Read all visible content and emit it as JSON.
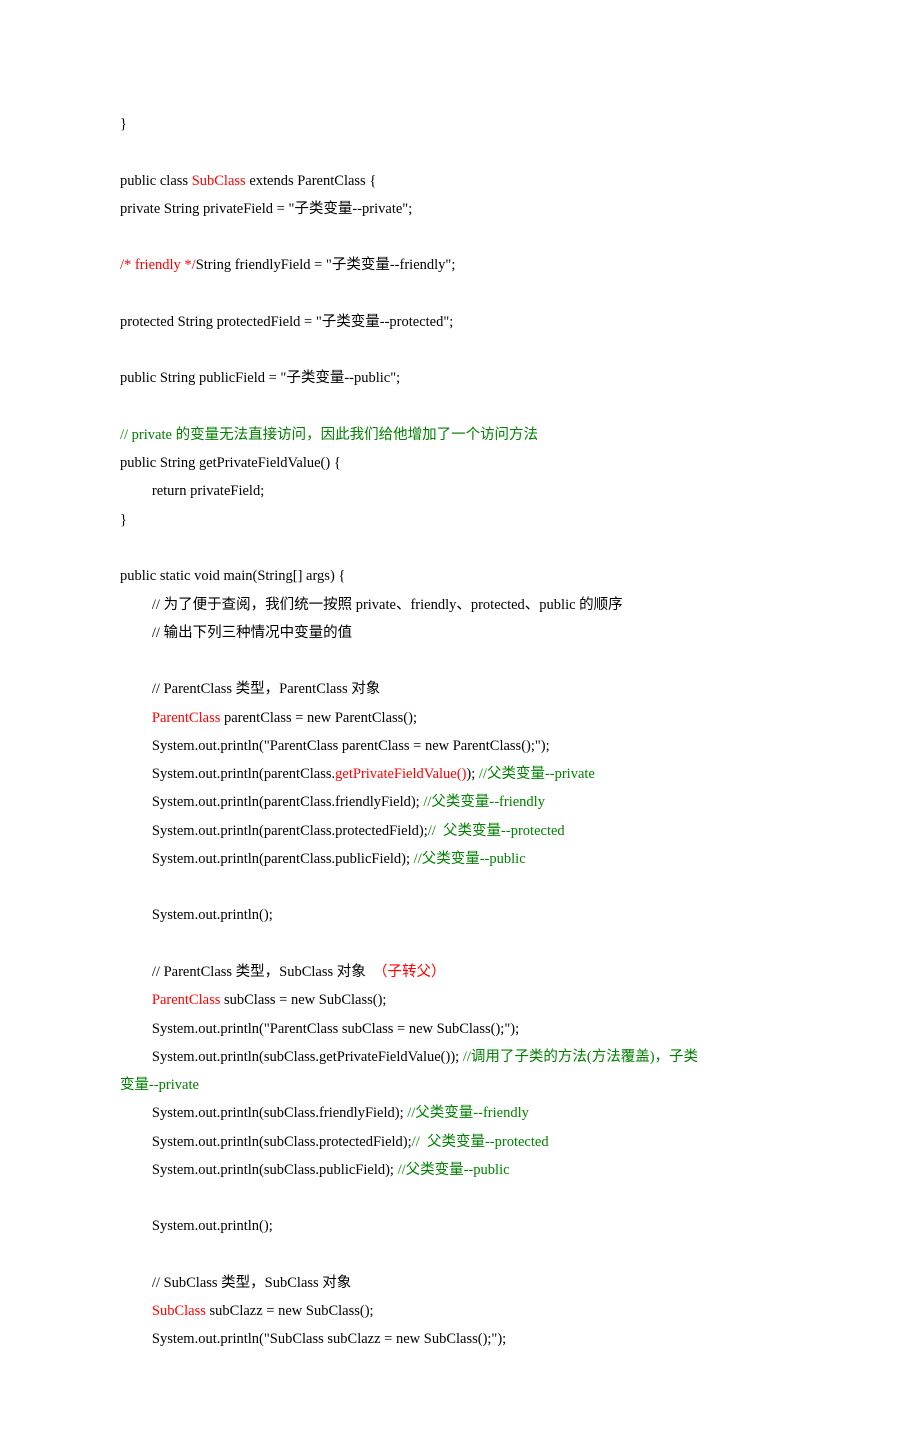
{
  "lines": [
    {
      "segments": [
        {
          "text": "}"
        }
      ]
    },
    {
      "segments": [
        {
          "text": ""
        }
      ]
    },
    {
      "segments": [
        {
          "text": "public class "
        },
        {
          "text": "SubClass",
          "color": "red"
        },
        {
          "text": " extends ParentClass {"
        }
      ]
    },
    {
      "segments": [
        {
          "text": "private String privateField = \"子类变量--private\";"
        }
      ]
    },
    {
      "segments": [
        {
          "text": ""
        }
      ]
    },
    {
      "segments": [
        {
          "text": "/* friendly */",
          "color": "red"
        },
        {
          "text": "String friendlyField = \"子类变量--friendly\";"
        }
      ]
    },
    {
      "segments": [
        {
          "text": ""
        }
      ]
    },
    {
      "segments": [
        {
          "text": "protected String protectedField = \"子类变量--protected\";"
        }
      ]
    },
    {
      "segments": [
        {
          "text": ""
        }
      ]
    },
    {
      "segments": [
        {
          "text": "public String publicField = \"子类变量--public\";"
        }
      ]
    },
    {
      "segments": [
        {
          "text": ""
        }
      ]
    },
    {
      "segments": [
        {
          "text": "// private 的变量无法直接访问，因此我们给他增加了一个访问方法",
          "color": "green"
        }
      ]
    },
    {
      "segments": [
        {
          "text": "public String getPrivateFieldValue() {"
        }
      ]
    },
    {
      "indent": 1,
      "segments": [
        {
          "text": "return privateField;"
        }
      ]
    },
    {
      "segments": [
        {
          "text": "}"
        }
      ]
    },
    {
      "segments": [
        {
          "text": ""
        }
      ]
    },
    {
      "segments": [
        {
          "text": "public static void main(String[] args) {"
        }
      ]
    },
    {
      "indent": 1,
      "segments": [
        {
          "text": "// 为了便于查阅，我们统一按照 private、friendly、protected、public 的顺序"
        }
      ]
    },
    {
      "indent": 1,
      "segments": [
        {
          "text": "// 输出下列三种情况中变量的值"
        }
      ]
    },
    {
      "segments": [
        {
          "text": ""
        }
      ]
    },
    {
      "indent": 1,
      "segments": [
        {
          "text": "// ParentClass 类型，ParentClass 对象"
        }
      ]
    },
    {
      "indent": 1,
      "segments": [
        {
          "text": "ParentClass",
          "color": "red"
        },
        {
          "text": " parentClass = new ParentClass();"
        }
      ]
    },
    {
      "indent": 1,
      "segments": [
        {
          "text": "System.out.println(\"ParentClass parentClass = new ParentClass();\");"
        }
      ]
    },
    {
      "indent": 1,
      "segments": [
        {
          "text": "System.out.println(parentClass."
        },
        {
          "text": "getPrivateFieldValue()",
          "color": "red"
        },
        {
          "text": "); "
        },
        {
          "text": "//父类变量--private",
          "color": "green"
        }
      ]
    },
    {
      "indent": 1,
      "segments": [
        {
          "text": "System.out.println(parentClass.friendlyField); "
        },
        {
          "text": "//父类变量--friendly",
          "color": "green"
        }
      ]
    },
    {
      "indent": 1,
      "segments": [
        {
          "text": "System.out.println(parentClass.protectedField);"
        },
        {
          "text": "//  父类变量--protected",
          "color": "green"
        }
      ]
    },
    {
      "indent": 1,
      "segments": [
        {
          "text": "System.out.println(parentClass.publicField); "
        },
        {
          "text": "//父类变量--public",
          "color": "green"
        }
      ]
    },
    {
      "segments": [
        {
          "text": ""
        }
      ]
    },
    {
      "indent": 1,
      "segments": [
        {
          "text": "System.out.println();"
        }
      ]
    },
    {
      "segments": [
        {
          "text": ""
        }
      ]
    },
    {
      "indent": 1,
      "segments": [
        {
          "text": "// ParentClass 类型，SubClass 对象  "
        },
        {
          "text": "（子转父）",
          "color": "red"
        }
      ]
    },
    {
      "indent": 1,
      "segments": [
        {
          "text": "ParentClass",
          "color": "red"
        },
        {
          "text": " subClass = new SubClass();"
        }
      ]
    },
    {
      "indent": 1,
      "segments": [
        {
          "text": "System.out.println(\"ParentClass subClass = new SubClass();\");"
        }
      ]
    },
    {
      "indent": 1,
      "segments": [
        {
          "text": "System.out.println(subClass.getPrivateFieldValue()); "
        },
        {
          "text": "//调用了子类的方法(方法覆盖)，子类",
          "color": "green"
        }
      ]
    },
    {
      "indent": -1,
      "segments": [
        {
          "text": "变量--private",
          "color": "green"
        }
      ]
    },
    {
      "indent": 1,
      "segments": [
        {
          "text": "System.out.println(subClass.friendlyField); "
        },
        {
          "text": "//父类变量--friendly",
          "color": "green"
        }
      ]
    },
    {
      "indent": 1,
      "segments": [
        {
          "text": "System.out.println(subClass.protectedField);"
        },
        {
          "text": "//  父类变量--protected",
          "color": "green"
        }
      ]
    },
    {
      "indent": 1,
      "segments": [
        {
          "text": "System.out.println(subClass.publicField); "
        },
        {
          "text": "//父类变量--public",
          "color": "green"
        }
      ]
    },
    {
      "segments": [
        {
          "text": ""
        }
      ]
    },
    {
      "indent": 1,
      "segments": [
        {
          "text": "System.out.println();"
        }
      ]
    },
    {
      "segments": [
        {
          "text": ""
        }
      ]
    },
    {
      "indent": 1,
      "segments": [
        {
          "text": "// SubClass 类型，SubClass 对象"
        }
      ]
    },
    {
      "indent": 1,
      "segments": [
        {
          "text": "SubClass",
          "color": "red"
        },
        {
          "text": " subClazz = new SubClass();"
        }
      ]
    },
    {
      "indent": 1,
      "segments": [
        {
          "text": "System.out.println(\"SubClass subClazz = new SubClass();\");"
        }
      ]
    }
  ]
}
